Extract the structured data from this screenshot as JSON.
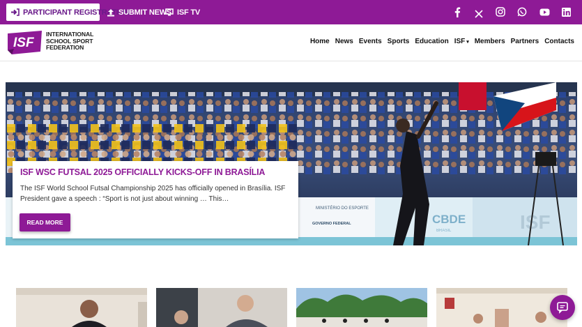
{
  "topbar": {
    "participant_label": "PARTICIPANT REGISTRATION",
    "submit_label": "SUBMIT NEWS",
    "tv_label": "ISF TV"
  },
  "social": [
    "facebook-icon",
    "x-icon",
    "instagram-icon",
    "whatsapp-icon",
    "youtube-icon",
    "linkedin-icon"
  ],
  "logo": {
    "mark": "ISF",
    "line1": "INTERNATIONAL",
    "line2": "SCHOOL SPORT",
    "line3": "FEDERATION"
  },
  "nav": {
    "items": [
      "Home",
      "News",
      "Events",
      "Sports",
      "Education",
      "ISF",
      "Members",
      "Partners",
      "Contacts"
    ]
  },
  "hero": {
    "title": "ISF WSC FUTSAL 2025 OFFICIALLY KICKS-OFF IN BRASÍLIA",
    "excerpt": "The ISF World School Futsal Championship 2025 has officially opened in Brasília. ISF President gave a speech : “Sport is not just about winning … This…",
    "button": "READ MORE",
    "banner_texts": [
      "MINISTÉRIO DO ESPORTE",
      "GOVERNO FEDERAL",
      "CBDE",
      "BRASIL",
      "ISF"
    ]
  },
  "colors": {
    "brand": "#8e1a96",
    "brand_dark": "#6a1a8a",
    "header_bg": "#ffffff"
  }
}
